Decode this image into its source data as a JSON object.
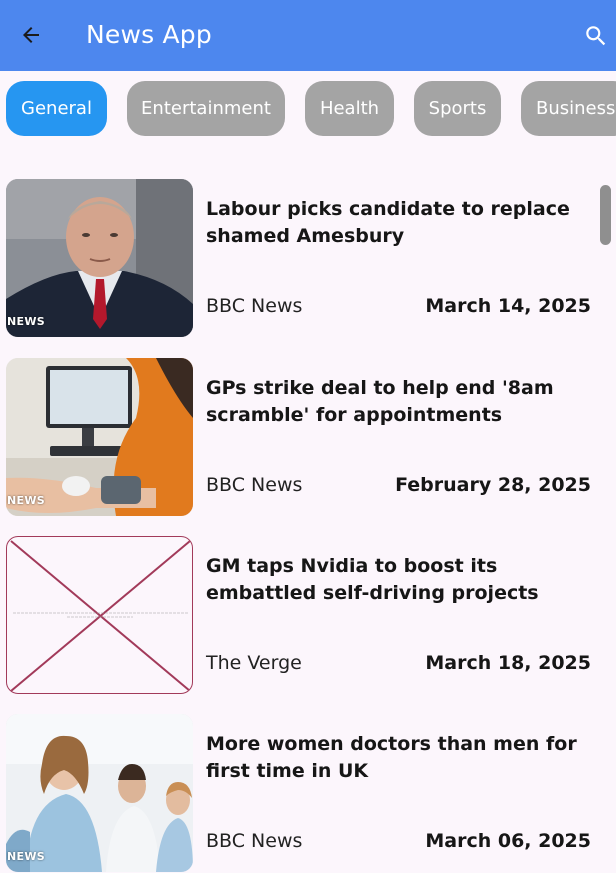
{
  "appbar": {
    "title": "News App",
    "back_icon": "arrow-back-icon",
    "search_icon": "search-icon",
    "color": "#4d87ee"
  },
  "categories": [
    {
      "label": "General",
      "active": true
    },
    {
      "label": "Entertainment",
      "active": false
    },
    {
      "label": "Health",
      "active": false
    },
    {
      "label": "Sports",
      "active": false
    },
    {
      "label": "Business",
      "active": false
    }
  ],
  "articles": [
    {
      "headline": "Labour picks candidate to replace shamed Amesbury",
      "source": "BBC News",
      "date": "March 14, 2025",
      "badge": "NEWS",
      "image": "photo-of-man-in-suit"
    },
    {
      "headline": "GPs strike deal to help end '8am scramble' for appointments",
      "source": "BBC News",
      "date": "February 28, 2025",
      "badge": "NEWS",
      "image": "photo-blood-pressure-check"
    },
    {
      "headline": "GM taps Nvidia to boost its embattled self-driving projects",
      "source": "The Verge",
      "date": "March 18, 2025",
      "badge": "",
      "image": "broken-image-placeholder"
    },
    {
      "headline": "More women doctors than men for first time in UK",
      "source": "BBC News",
      "date": "March 06, 2025",
      "badge": "NEWS",
      "image": "photo-group-of-doctors"
    }
  ]
}
